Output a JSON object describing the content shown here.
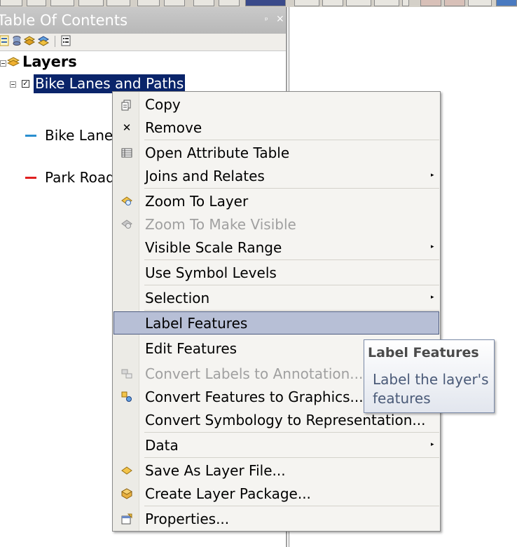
{
  "panel": {
    "title": "Table Of Contents",
    "pin_glyph": "ᵖ",
    "close_glyph": "×"
  },
  "tree": {
    "root_label": "Layers",
    "layer_name": "Bike Lanes and Paths",
    "legend": [
      {
        "label": "Bike Lanes",
        "color": "#2a8fd0"
      },
      {
        "label": "Park Roads",
        "color": "#e02020"
      }
    ]
  },
  "menu": {
    "items": [
      {
        "label": "Copy",
        "icon": "copy-icon",
        "enabled": true
      },
      {
        "label": "Remove",
        "icon": "remove-icon",
        "enabled": true
      },
      {
        "label": "Open Attribute Table",
        "icon": "table-icon",
        "enabled": true
      },
      {
        "label": "Joins and Relates",
        "icon": "",
        "enabled": true,
        "submenu": true
      },
      {
        "label": "Zoom To Layer",
        "icon": "zoom-to-layer-icon",
        "enabled": true
      },
      {
        "label": "Zoom To Make Visible",
        "icon": "zoom-visible-icon",
        "enabled": false
      },
      {
        "label": "Visible Scale Range",
        "icon": "",
        "enabled": true,
        "submenu": true
      },
      {
        "label": "Use Symbol Levels",
        "icon": "",
        "enabled": true
      },
      {
        "label": "Selection",
        "icon": "",
        "enabled": true,
        "submenu": true
      },
      {
        "label": "Label Features",
        "icon": "",
        "enabled": true,
        "highlighted": true
      },
      {
        "label": "Edit Features",
        "icon": "",
        "enabled": true
      },
      {
        "label": "Convert Labels to Annotation...",
        "icon": "convert-labels-icon",
        "enabled": false
      },
      {
        "label": "Convert Features to Graphics...",
        "icon": "convert-graphics-icon",
        "enabled": true
      },
      {
        "label": "Convert Symbology to Representation...",
        "icon": "",
        "enabled": true
      },
      {
        "label": "Data",
        "icon": "",
        "enabled": true,
        "submenu": true
      },
      {
        "label": "Save As Layer File...",
        "icon": "layer-file-icon",
        "enabled": true
      },
      {
        "label": "Create Layer Package...",
        "icon": "layer-package-icon",
        "enabled": true
      },
      {
        "label": "Properties...",
        "icon": "properties-icon",
        "enabled": true
      }
    ],
    "submenu_arrow": "▸"
  },
  "tooltip": {
    "title": "Label Features",
    "body": "Label the layer's features"
  },
  "colors": {
    "selection": "#0a246a",
    "highlight": "#b7bfd6",
    "bike_lanes": "#2a8fd0",
    "park_roads": "#e02020"
  }
}
